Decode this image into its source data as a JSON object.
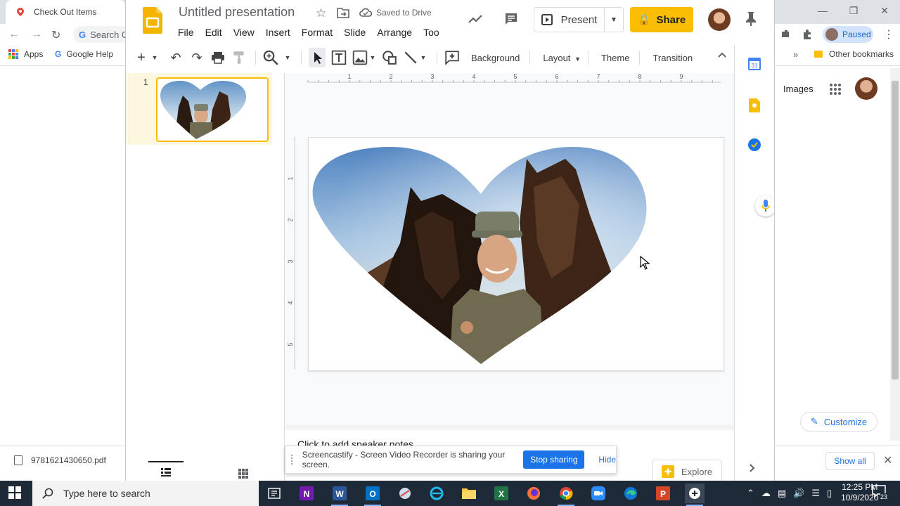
{
  "browser": {
    "tab_title": "Check Out Items",
    "omnibox_text": "Search G",
    "bookmarks": {
      "apps": "Apps",
      "google_help": "Google Help",
      "other": "Other bookmarks"
    },
    "profile_status": "Paused",
    "page_images_link": "Images",
    "customize_label": "Customize"
  },
  "download_bar": {
    "file_name": "9781621430650.pdf",
    "show_all": "Show all"
  },
  "slides": {
    "title": "Untitled presentation",
    "save_status": "Saved to Drive",
    "menus": [
      "File",
      "Edit",
      "View",
      "Insert",
      "Format",
      "Slide",
      "Arrange",
      "Too"
    ],
    "present_label": "Present",
    "share_label": "Share",
    "toolbar": {
      "background": "Background",
      "layout": "Layout",
      "theme": "Theme",
      "transition": "Transition"
    },
    "ruler_h": [
      "1",
      "2",
      "3",
      "4",
      "5",
      "6",
      "7",
      "8",
      "9"
    ],
    "ruler_v": [
      "1",
      "2",
      "3",
      "4",
      "5"
    ],
    "slide_number": "1",
    "speaker_notes_placeholder": "Click to add speaker notes",
    "explore_label": "Explore"
  },
  "screencastify": {
    "message": "Screencastify - Screen Video Recorder is sharing your screen.",
    "stop_label": "Stop sharing",
    "hide_label": "Hide"
  },
  "taskbar": {
    "search_placeholder": "Type here to search",
    "time": "12:25 PM",
    "date": "10/9/2020",
    "notification_count": "23"
  },
  "colors": {
    "share_yellow": "#fbbc04",
    "link_blue": "#1a73e8",
    "taskbar": "#1f2a38",
    "selection_highlight": "#fef7e0"
  }
}
